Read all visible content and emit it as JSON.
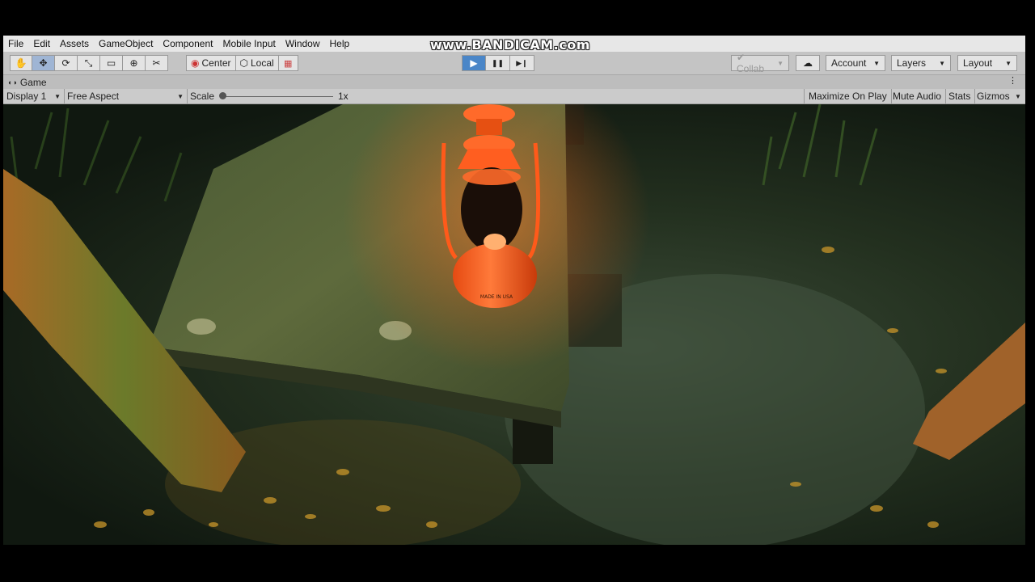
{
  "watermark": "www.BANDICAM.com",
  "menu": [
    "File",
    "Edit",
    "Assets",
    "GameObject",
    "Component",
    "Mobile Input",
    "Window",
    "Help"
  ],
  "toolbar": {
    "tools": [
      {
        "name": "hand-tool-icon",
        "glyph": "✋"
      },
      {
        "name": "move-tool-icon",
        "glyph": "✥"
      },
      {
        "name": "rotate-tool-icon",
        "glyph": "⟳"
      },
      {
        "name": "scale-tool-icon",
        "glyph": "⤡"
      },
      {
        "name": "rect-tool-icon",
        "glyph": "▭"
      },
      {
        "name": "transform-tool-icon",
        "glyph": "⊕"
      },
      {
        "name": "custom-tool-icon",
        "glyph": "✂"
      }
    ],
    "pivot_label": "Center",
    "space_label": "Local",
    "play_glyph": "▶",
    "pause_glyph": "❚❚",
    "step_glyph": "▶❙",
    "collab_label": "Collab",
    "cloud_glyph": "☁",
    "account_label": "Account",
    "layers_label": "Layers",
    "layout_label": "Layout"
  },
  "game_tab": {
    "label": "Game",
    "display": "Display 1",
    "aspect": "Free Aspect",
    "scale_label": "Scale",
    "scale_value": "1x",
    "maximize": "Maximize On Play",
    "mute": "Mute Audio",
    "stats": "Stats",
    "gizmos": "Gizmos"
  },
  "scene": {
    "lantern_label": "MADE IN USA"
  }
}
